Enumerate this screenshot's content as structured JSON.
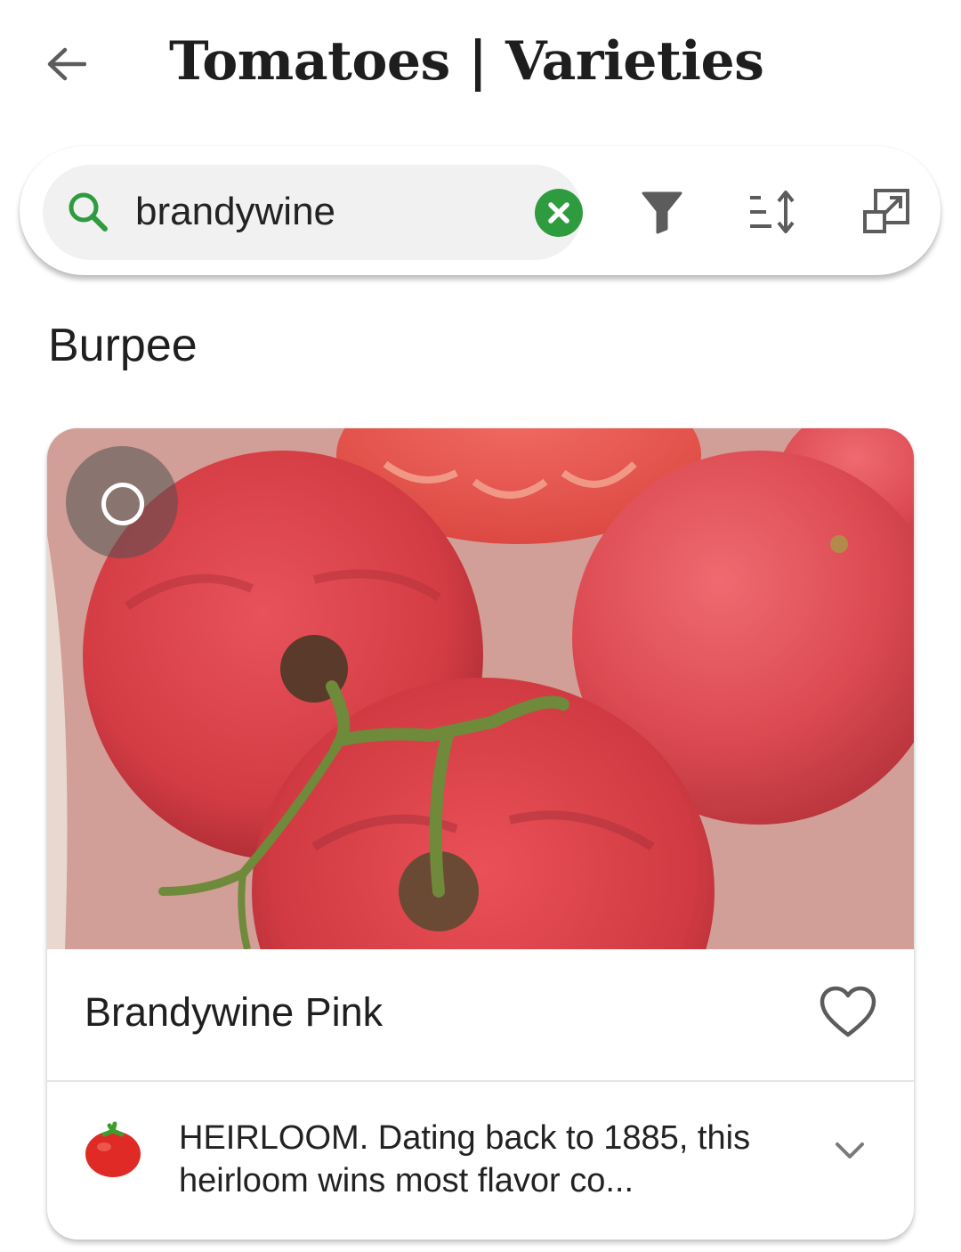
{
  "header": {
    "title": "Tomatoes | Varieties",
    "back_icon": "arrow-left-icon"
  },
  "search": {
    "value": "brandywine",
    "placeholder": "",
    "accent_color": "#2e9b3e",
    "icons": [
      "search-icon",
      "clear-icon",
      "filter-icon",
      "sort-icon",
      "expand-view-icon"
    ]
  },
  "section": {
    "label": "Burpee"
  },
  "card": {
    "name": "Brandywine Pink",
    "description": "HEIRLOOM. Dating back to 1885, this heirloom wins most flavor co...",
    "selected": false,
    "favorite": false,
    "category_icon": "tomato-icon",
    "image": "tomatoes-photo"
  }
}
